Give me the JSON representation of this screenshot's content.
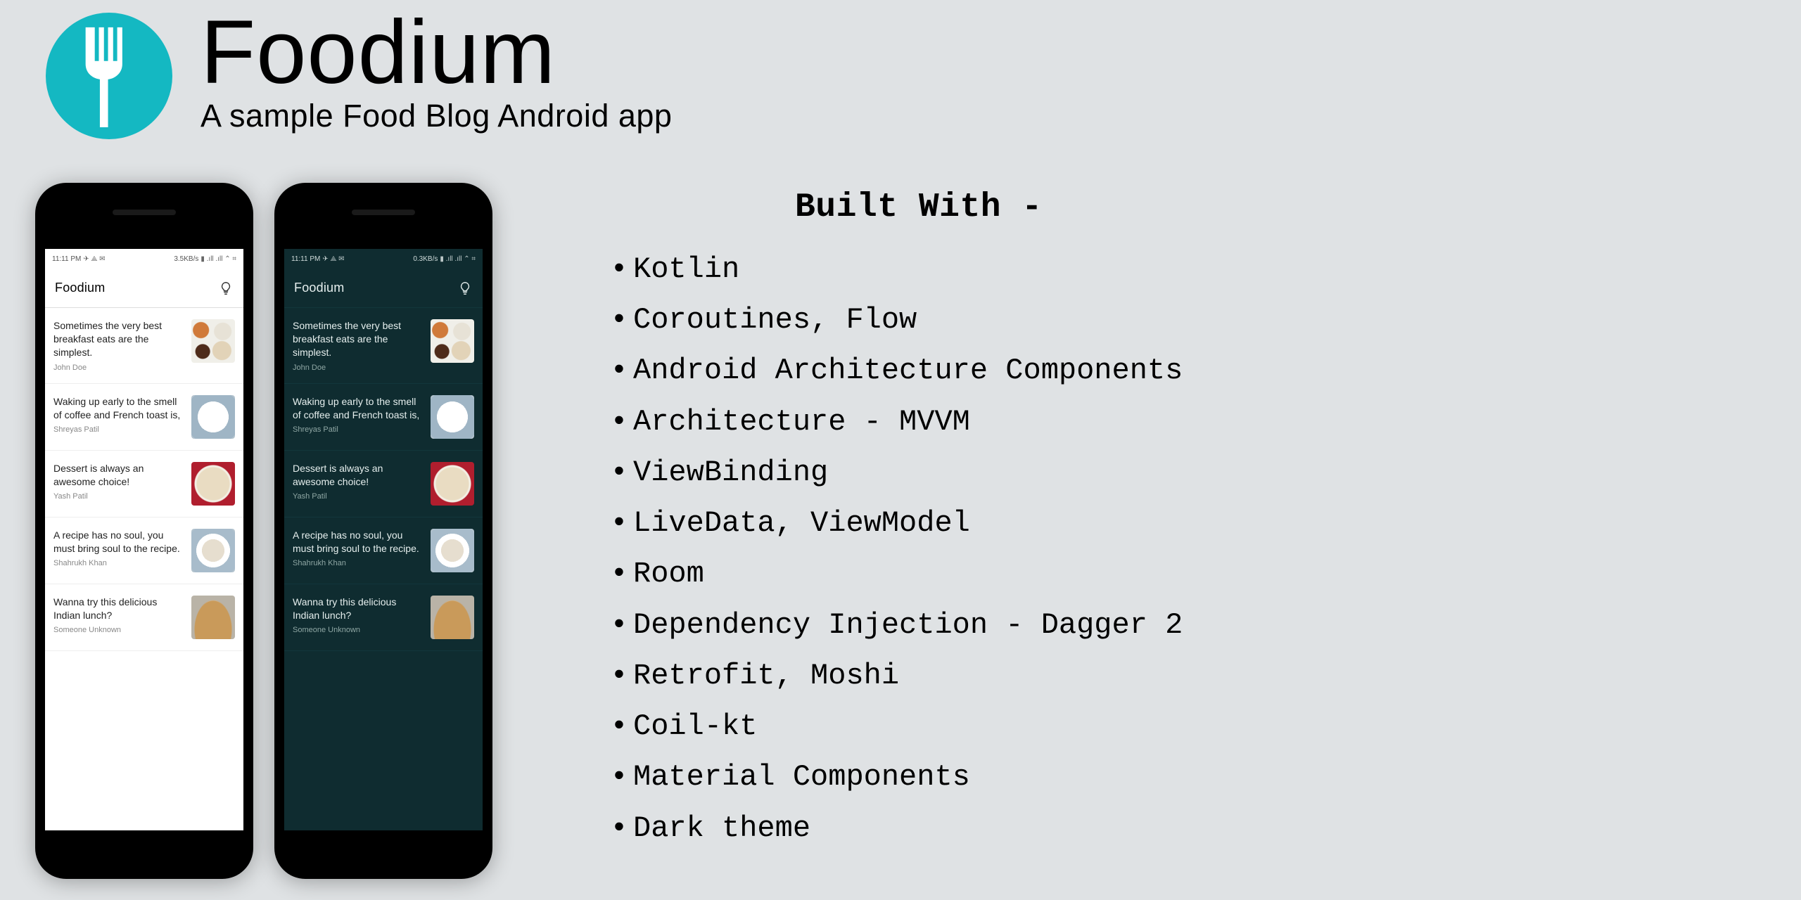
{
  "header": {
    "title": "Foodium",
    "subtitle": "A sample Food Blog Android app",
    "logo_icon": "fork-icon"
  },
  "built_with": {
    "heading": "Built With -",
    "items": [
      "Kotlin",
      "Coroutines, Flow",
      "Android Architecture Components",
      "Architecture - MVVM",
      "ViewBinding",
      "LiveData, ViewModel",
      "Room",
      "Dependency Injection - Dagger 2",
      "Retrofit, Moshi",
      "Coil-kt",
      "Material Components",
      "Dark theme"
    ]
  },
  "app_common": {
    "app_bar_title": "Foodium",
    "status": {
      "time": "11:11 PM",
      "icons_left": "✈ ⟁ ✉",
      "icons_right": "▮ .ıll .ıll ⌃ ⌗"
    },
    "posts": [
      {
        "title": "Sometimes the very best breakfast eats are the simplest.",
        "author": "John Doe",
        "thumb": "thumb-1"
      },
      {
        "title": "Waking up early to the smell of coffee and French toast is,",
        "author": "Shreyas Patil",
        "thumb": "thumb-2"
      },
      {
        "title": "Dessert is always an awesome choice!",
        "author": "Yash Patil",
        "thumb": "thumb-3"
      },
      {
        "title": "A recipe has no soul, you must bring soul to the recipe.",
        "author": "Shahrukh Khan",
        "thumb": "thumb-4"
      },
      {
        "title": "Wanna try this delicious Indian lunch?",
        "author": "Someone Unknown",
        "thumb": "thumb-5"
      }
    ]
  },
  "phones": {
    "light": {
      "net_rate": "3.5KB/s"
    },
    "dark": {
      "net_rate": "0.3KB/s"
    }
  }
}
